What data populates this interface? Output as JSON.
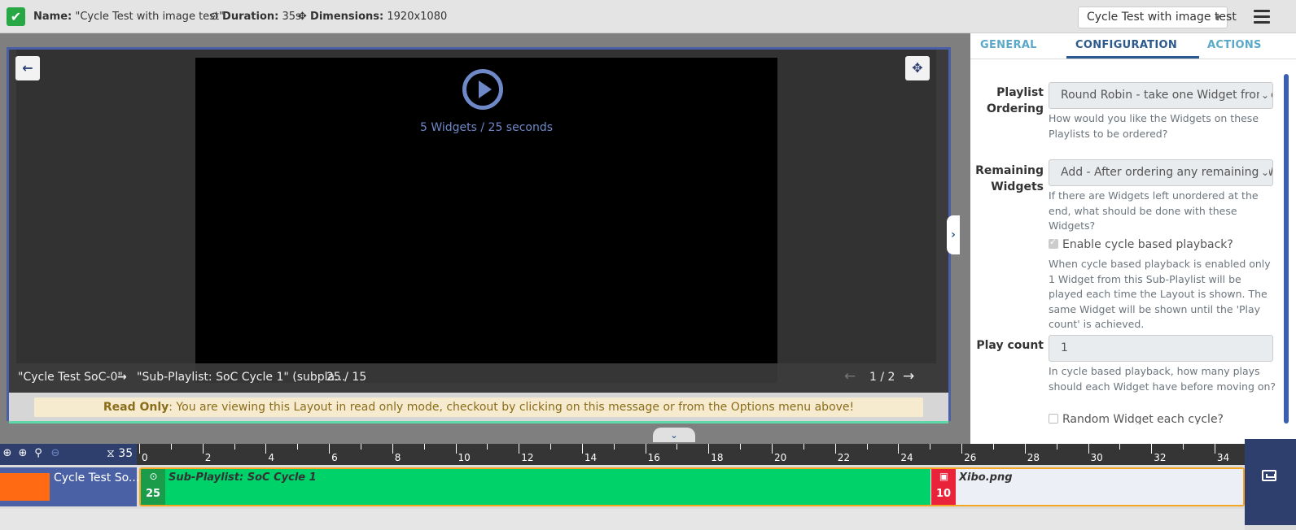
{
  "header": {
    "name_label": "Name:",
    "name_value": "\"Cycle Test with image test\"",
    "duration_label": "Duration:",
    "duration_value": "35s",
    "dimensions_label": "Dimensions:",
    "dimensions_value": "1920x1080",
    "layout_select": "Cycle Test with image test"
  },
  "viewer": {
    "widgets_info": "5 Widgets / 25 seconds",
    "breadcrumb_region": "\"Cycle Test SoC-0\"",
    "breadcrumb_playlist": "\"Sub-Playlist: SoC Cycle 1\" (subpla...",
    "breadcrumb_count": "25 / 15",
    "pager": "1 / 2",
    "readonly_title": "Read Only",
    "readonly_text": ": You are viewing this Layout in read only mode, checkout by clicking on this message or from the Options menu above!"
  },
  "panel": {
    "tabs": [
      "GENERAL",
      "CONFIGURATION",
      "ACTIONS"
    ],
    "playlist_ordering_label_1": "Playlist",
    "playlist_ordering_label_2": "Ordering",
    "playlist_ordering_value": "Round Robin - take one Widget from e",
    "playlist_ordering_help": "How would you like the Widgets on these Playlists to be ordered?",
    "remaining_label_1": "Remaining",
    "remaining_label_2": "Widgets",
    "remaining_value": "Add - After ordering any remaining W",
    "remaining_help": "If there are Widgets left unordered at the end, what should be done with these Widgets?",
    "cycle_checkbox_label": "Enable cycle based playback?",
    "cycle_help": "When cycle based playback is enabled only 1 Widget from this Sub-Playlist will be played each time the Layout is shown. The same Widget will be shown until the 'Play count' is achieved.",
    "play_count_label": "Play count",
    "play_count_value": "1",
    "play_count_help": "In cycle based playback, how many plays should each Widget have before moving on?",
    "random_checkbox_label": "Random Widget each cycle?"
  },
  "timeline": {
    "duration": "35",
    "ticks": [
      "0",
      "2",
      "4",
      "6",
      "8",
      "10",
      "12",
      "14",
      "16",
      "18",
      "20",
      "22",
      "24",
      "26",
      "28",
      "30",
      "32",
      "34"
    ],
    "region_name": "Cycle Test So...",
    "widgets": [
      {
        "name": "Sub-Playlist: SoC Cycle 1",
        "duration": "25",
        "color": "#00d26a",
        "icon": "play-circle-icon"
      },
      {
        "name": "Xibo.png",
        "duration": "10",
        "color": "#e8233a",
        "icon": "image-file-icon"
      }
    ]
  },
  "colors": {
    "accent": "#2d5a8e",
    "playlist_green": "#00d26a",
    "region_orange": "#ff6a13",
    "timeline_navy": "#2e3f6e"
  }
}
